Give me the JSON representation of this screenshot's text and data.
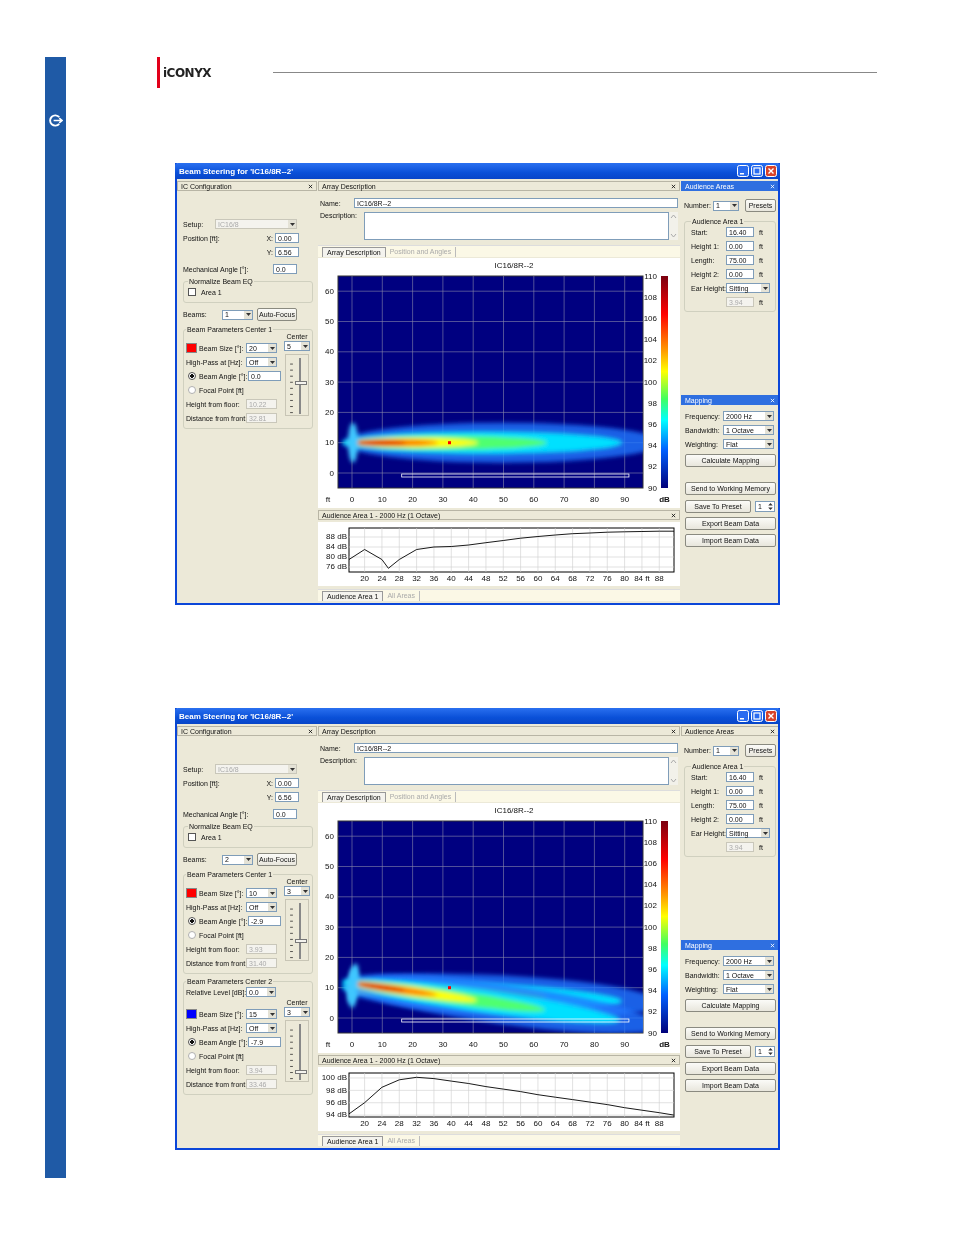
{
  "header": {
    "logo": "iCONYX"
  },
  "windows": [
    {
      "title": "Beam Steering for 'IC16/8R--2'",
      "ic_config": {
        "header": "IC Configuration",
        "active": false,
        "setup_label": "Setup:",
        "setup_value": "IC16/8",
        "position_label": "Position [ft]:",
        "x_label": "X:",
        "x_value": "0.00",
        "y_label": "Y:",
        "y_value": "6.56",
        "mech_label": "Mechanical Angle [°]:",
        "mech_value": "0.0",
        "normalize_title": "Normalize Beam EQ",
        "normalize_areas": [
          {
            "label": "Area 1",
            "checked": false
          }
        ],
        "beams_label": "Beams:",
        "beams_value": "1",
        "autofocus_button": "Auto-Focus",
        "centers": [
          {
            "title": "Beam Parameters Center 1",
            "color": "#ff0000",
            "center_label": "Center",
            "beam_size_label": "Beam Size [°]:",
            "beam_size_value": "20",
            "center_value": "5",
            "highpass_label": "High-Pass at [Hz]:",
            "highpass_value": "Off",
            "options": [
              {
                "label": "Beam Angle [°]:",
                "selected": true,
                "value": "0.0"
              },
              {
                "label": "Focal Point [ft]",
                "selected": false
              }
            ],
            "height_label": "Height from floor:",
            "height_value": "10.22",
            "distance_label": "Distance from front:",
            "distance_value": "32.81",
            "level": 0.56
          }
        ]
      },
      "array": {
        "header": "Array Description",
        "active": false,
        "name_label": "Name:",
        "name_value": "IC16/8R--2",
        "description_label": "Description:",
        "tabs": [
          {
            "label": "Array Description",
            "selected": true
          },
          {
            "label": "Position and Angles",
            "selected": false
          }
        ],
        "map": {
          "title": "IC16/8R--2",
          "yticks": [
            "60",
            "50",
            "40",
            "30",
            "20",
            "10",
            "0"
          ],
          "x_unit": "ft",
          "xticks": [
            "0",
            "10",
            "20",
            "30",
            "40",
            "50",
            "60",
            "70",
            "80",
            "90"
          ],
          "scale_ticks": [
            "110",
            "108",
            "106",
            "104",
            "102",
            "100",
            "98",
            "96",
            "94",
            "92",
            "90"
          ],
          "scale_unit": "dB"
        }
      },
      "response": {
        "header": "Audience Area 1 - 2000 Hz (1 Octave)",
        "tabs": [
          {
            "label": "Audience Area 1",
            "selected": true
          },
          {
            "label": "All Areas",
            "selected": false
          }
        ],
        "chart_data": {
          "type": "line",
          "grid": true,
          "x": [
            16.4,
            20,
            24,
            25.5,
            28,
            32,
            36,
            40,
            44,
            48,
            52,
            56,
            60,
            64,
            68,
            72,
            76,
            80,
            84,
            88,
            91.4
          ],
          "series": [
            {
              "color": "#000000",
              "values": [
                79,
                83,
                79,
                75.5,
                79,
                83,
                84,
                84.2,
                84.8,
                85.7,
                86.6,
                87.5,
                88.2,
                88.8,
                89.3,
                89.6,
                89.9,
                90.1,
                90.2,
                90.3,
                90.3
              ]
            }
          ],
          "xlim": [
            16.4,
            91.4
          ],
          "ylim": [
            74,
            91.6
          ],
          "xticks": [
            20,
            24,
            28,
            32,
            36,
            40,
            44,
            48,
            52,
            56,
            60,
            64,
            68,
            72,
            76,
            80,
            {
              "value": 84,
              "label": "84 ft"
            },
            88
          ],
          "yticks": [
            {
              "value": 76,
              "label": "76 dB"
            },
            {
              "value": 80,
              "label": "80 dB"
            },
            {
              "value": 84,
              "label": "84 dB"
            },
            {
              "value": 88,
              "label": "88 dB"
            }
          ]
        }
      },
      "audience": {
        "header": "Audience Areas",
        "active": true,
        "number_label": "Number:",
        "number_value": "1",
        "presets_button": "Presets",
        "group_title": "Audience Area 1",
        "fields": [
          {
            "kind": "input",
            "label": "Start:",
            "value": "16.40",
            "unit": "ft"
          },
          {
            "kind": "input",
            "label": "Height 1:",
            "value": "0.00",
            "unit": "ft"
          },
          {
            "kind": "input",
            "label": "Length:",
            "value": "75.00",
            "unit": "ft"
          },
          {
            "kind": "input",
            "label": "Height 2:",
            "value": "0.00",
            "unit": "ft"
          },
          {
            "kind": "select",
            "label": "Ear Height:",
            "value": "Sitting"
          },
          {
            "kind": "disabled",
            "value": "3.94",
            "unit": "ft"
          }
        ]
      },
      "mapping": {
        "header": "Mapping",
        "active": true,
        "fields": [
          {
            "label": "Frequency:",
            "value": "2000 Hz"
          },
          {
            "label": "Bandwidth:",
            "value": "1 Octave"
          },
          {
            "label": "Weighting:",
            "value": "Flat"
          }
        ],
        "calculate_button": "Calculate Mapping"
      },
      "send_button": "Send to Working Memory",
      "save_button": "Save To Preset",
      "preset_value": "1",
      "export_button": "Export Beam Data",
      "import_button": "Import Beam Data"
    },
    {
      "title": "Beam Steering for 'IC16/8R--2'",
      "ic_config": {
        "header": "IC Configuration",
        "active": false,
        "setup_label": "Setup:",
        "setup_value": "IC16/8",
        "position_label": "Position [ft]:",
        "x_label": "X:",
        "x_value": "0.00",
        "y_label": "Y:",
        "y_value": "6.56",
        "mech_label": "Mechanical Angle [°]:",
        "mech_value": "0.0",
        "normalize_title": "Normalize Beam EQ",
        "normalize_areas": [
          {
            "label": "Area 1",
            "checked": false
          }
        ],
        "beams_label": "Beams:",
        "beams_value": "2",
        "autofocus_button": "Auto-Focus",
        "centers": [
          {
            "title": "Beam Parameters Center 1",
            "color": "#ff0000",
            "center_label": "Center",
            "beam_size_label": "Beam Size [°]:",
            "beam_size_value": "10",
            "center_value": "3",
            "highpass_label": "High-Pass at [Hz]:",
            "highpass_value": "Off",
            "options": [
              {
                "label": "Beam Angle [°]:",
                "selected": true,
                "value": "-2.9"
              },
              {
                "label": "Focal Point [ft]",
                "selected": false
              }
            ],
            "height_label": "Height from floor:",
            "height_value": "3.93",
            "distance_label": "Distance from front:",
            "distance_value": "31.40",
            "level": 0.32
          },
          {
            "title": "Beam Parameters Center 2",
            "relative_label": "Relative Level [dB]:",
            "relative_value": "0.0",
            "color": "#0000ff",
            "center_label": "Center",
            "beam_size_label": "Beam Size [°]:",
            "beam_size_value": "15",
            "center_value": "3",
            "highpass_label": "High-Pass at [Hz]:",
            "highpass_value": "Off",
            "options": [
              {
                "label": "Beam Angle [°]:",
                "selected": true,
                "value": "-7.9"
              },
              {
                "label": "Focal Point [ft]",
                "selected": false
              }
            ],
            "height_label": "Height from floor:",
            "height_value": "3.94",
            "distance_label": "Distance from front:",
            "distance_value": "33.46",
            "level": 0.13
          }
        ]
      },
      "array": {
        "header": "Array Description",
        "active": false,
        "name_label": "Name:",
        "name_value": "IC16/8R--2",
        "description_label": "Description:",
        "tabs": [
          {
            "label": "Array Description",
            "selected": true
          },
          {
            "label": "Position and Angles",
            "selected": false
          }
        ],
        "map": {
          "title": "IC16/8R--2",
          "yticks": [
            "60",
            "50",
            "40",
            "30",
            "20",
            "10",
            "0"
          ],
          "x_unit": "ft",
          "xticks": [
            "0",
            "10",
            "20",
            "30",
            "40",
            "50",
            "60",
            "70",
            "80",
            "90"
          ],
          "scale_ticks": [
            "110",
            "108",
            "106",
            "104",
            "102",
            "100",
            "98",
            "96",
            "94",
            "92",
            "90"
          ],
          "scale_unit": "dB"
        }
      },
      "response": {
        "header": "Audience Area 1 - 2000 Hz (1 Octave)",
        "tabs": [
          {
            "label": "Audience Area 1",
            "selected": true
          },
          {
            "label": "All Areas",
            "selected": false
          }
        ],
        "chart_data": {
          "type": "line",
          "grid": true,
          "x": [
            16.4,
            20,
            24,
            28,
            32,
            36,
            40,
            44,
            48,
            52,
            56,
            60,
            64,
            68,
            72,
            76,
            80,
            84,
            88,
            91.4
          ],
          "series": [
            {
              "color": "#000000",
              "values": [
                94.2,
                96,
                98.5,
                99.7,
                100.1,
                99.9,
                99.5,
                99.1,
                98.6,
                98.2,
                97.8,
                97.3,
                96.9,
                96.5,
                96.1,
                95.7,
                95.2,
                94.8,
                94.4,
                94
              ]
            }
          ],
          "xlim": [
            16.4,
            91.4
          ],
          "ylim": [
            93.7,
            100.8
          ],
          "xticks": [
            20,
            24,
            28,
            32,
            36,
            40,
            44,
            48,
            52,
            56,
            60,
            64,
            68,
            72,
            76,
            80,
            {
              "value": 84,
              "label": "84 ft"
            },
            88
          ],
          "yticks": [
            {
              "value": 94,
              "label": "94 dB"
            },
            {
              "value": 96,
              "label": "96 dB"
            },
            {
              "value": 98,
              "label": "98 dB"
            },
            {
              "value": 100,
              "label": "100 dB"
            }
          ]
        }
      },
      "audience": {
        "header": "Audience Areas",
        "active": false,
        "number_label": "Number:",
        "number_value": "1",
        "presets_button": "Presets",
        "group_title": "Audience Area 1",
        "fields": [
          {
            "kind": "input",
            "label": "Start:",
            "value": "16.40",
            "unit": "ft"
          },
          {
            "kind": "input",
            "label": "Height 1:",
            "value": "0.00",
            "unit": "ft"
          },
          {
            "kind": "input",
            "label": "Length:",
            "value": "75.00",
            "unit": "ft"
          },
          {
            "kind": "input",
            "label": "Height 2:",
            "value": "0.00",
            "unit": "ft"
          },
          {
            "kind": "select",
            "label": "Ear Height:",
            "value": "Sitting"
          },
          {
            "kind": "disabled",
            "value": "3.94",
            "unit": "ft"
          }
        ]
      },
      "mapping": {
        "header": "Mapping",
        "active": true,
        "fields": [
          {
            "label": "Frequency:",
            "value": "2000 Hz"
          },
          {
            "label": "Bandwidth:",
            "value": "1 Octave"
          },
          {
            "label": "Weighting:",
            "value": "Flat"
          }
        ],
        "calculate_button": "Calculate Mapping"
      },
      "send_button": "Send to Working Memory",
      "save_button": "Save To Preset",
      "preset_value": "1",
      "export_button": "Export Beam Data",
      "import_button": "Import Beam Data"
    }
  ]
}
